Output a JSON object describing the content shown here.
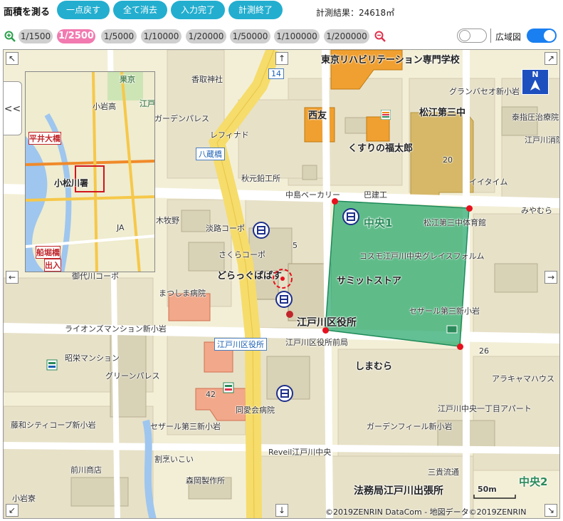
{
  "toolbar": {
    "title": "面積を測る",
    "buttons": [
      "一点戻す",
      "全て消去",
      "入力完了",
      "計測終了"
    ],
    "result_label": "計測結果：",
    "result_value": "24618㎡"
  },
  "scales": {
    "items": [
      "1/1500",
      "1/2500",
      "1/5000",
      "1/10000",
      "1/20000",
      "1/50000",
      "1/100000",
      "1/200000"
    ],
    "active": "1/2500",
    "wide_map_label": "広域図",
    "wide_map_on": true,
    "left_toggle_on": false
  },
  "map": {
    "north": "N",
    "scale_text": "50m",
    "copyright": "©2019ZENRIN DataCom - 地図データ©2019ZENRIN",
    "collapse_glyph": "<<",
    "labels": {
      "school": "東京リハビリテーション専門学校",
      "grandbase": "グランバセオ新小岩",
      "taishi": "泰指圧治療院",
      "edogawa_clinic": "江戸川消防",
      "seiyu": "西友",
      "kusuri": "くすりの福太郎",
      "matsue3": "松江第三中",
      "matsue_gym": "松江第三中体育館",
      "nakajima": "中島ベーカリー",
      "barken": "巴建工",
      "itaimu": "イイタイム",
      "miyamoro": "みやむら",
      "chuo1": "中央1",
      "cosmo": "コスモ江戸川中央グレイスフォルム",
      "summit": "サミットストア",
      "sezar": "セザール第三新小岩",
      "kuyakusho": "江戸川区役所",
      "kuyakusho_box": "江戸川区役所",
      "kuyakusho_mae": "江戸川区役所前局",
      "shimamura": "しまむら",
      "garden_palace": "ガーデンパレス",
      "refride": "レフィナド",
      "kashiba": "香取神社",
      "hachizo": "八蔵橋",
      "akimoto": "秋元鉛工所",
      "awaji": "淡路コーポ",
      "sakura": "さくらコーポ",
      "drugpapa": "どらっぐぱぱす",
      "matsushima": "まつしま病院",
      "lions": "ライオンズマンション新小岩",
      "showa": "昭栄マンション",
      "green_palace": "グリーンパレス",
      "doai": "同愛会病院",
      "sezar2": "セザール第三新小岩",
      "gardenfeel": "ガーデンフィール新小岩",
      "edo_chuo1": "江戸川中央一丁目アパート",
      "arakiya": "アラキャマハウス",
      "reveil": "Reveil江戸川中央",
      "kappou": "割烹いこい",
      "morioka": "森岡製作所",
      "ramen": "三貴流通",
      "houmukyoku": "法務局江戸川出張所",
      "chuo2": "中央2",
      "fujimi": "藤和シティコープ新小岩",
      "maekawa": "前川商店",
      "koiwa_ryo": "小岩寮",
      "bokumeiki": "木牧野",
      "mikawa": "御代川コーポ",
      "konaka": "小松川署",
      "hiraibashi": "平井大橋",
      "funaboribashi": "船堀橋",
      "ja": "JA",
      "koiwa_shiba": "小岩高",
      "edo_big": "江戸",
      "ken_big": "果京",
      "num_20": "20",
      "num_42": "42",
      "num_26": "26",
      "num_5": "5",
      "num_14": "14",
      "deguchi": "出入"
    }
  }
}
